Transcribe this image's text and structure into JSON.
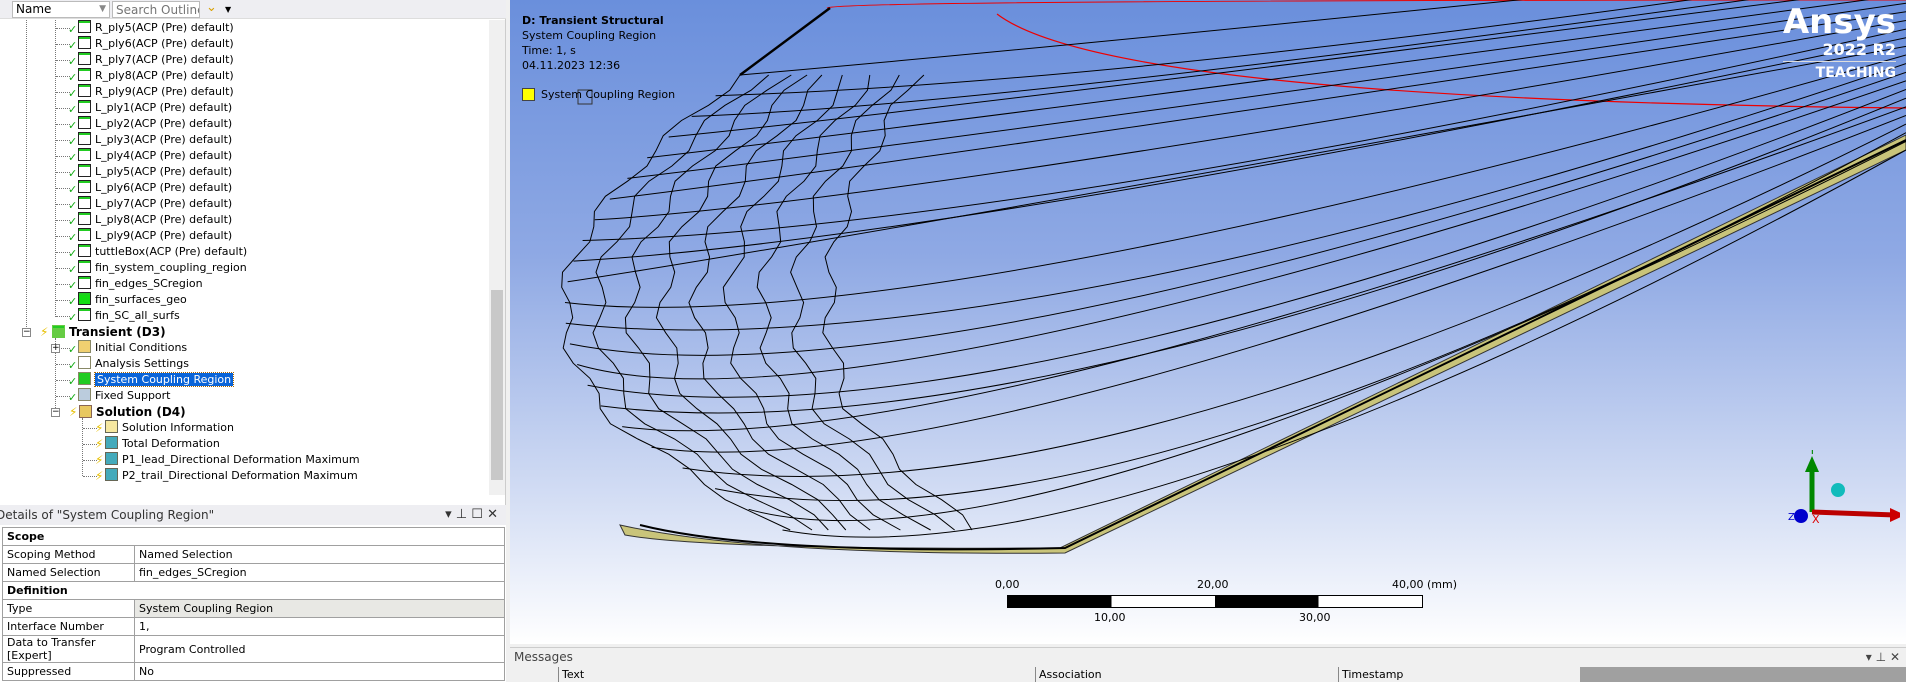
{
  "toolbar": {
    "name_filter": "Name",
    "search_placeholder": "Search Outline"
  },
  "tree": {
    "leaf_items": [
      "R_ply5(ACP (Pre) default)",
      "R_ply6(ACP (Pre) default)",
      "R_ply7(ACP (Pre) default)",
      "R_ply8(ACP (Pre) default)",
      "R_ply9(ACP (Pre) default)",
      "L_ply1(ACP (Pre) default)",
      "L_ply2(ACP (Pre) default)",
      "L_ply3(ACP (Pre) default)",
      "L_ply4(ACP (Pre) default)",
      "L_ply5(ACP (Pre) default)",
      "L_ply6(ACP (Pre) default)",
      "L_ply7(ACP (Pre) default)",
      "L_ply8(ACP (Pre) default)",
      "L_ply9(ACP (Pre) default)",
      "tuttleBox(ACP (Pre) default)",
      "fin_system_coupling_region",
      "fin_edges_SCregion",
      "fin_surfaces_geo",
      "fin_SC_all_surfs"
    ],
    "transient": "Transient (D3)",
    "transient_items": [
      "Initial Conditions",
      "Analysis Settings",
      "System Coupling Region",
      "Fixed Support"
    ],
    "solution": "Solution (D4)",
    "solution_items": [
      "Solution Information",
      "Total Deformation",
      "P1_lead_Directional Deformation Maximum",
      "P2_trail_Directional Deformation Maximum"
    ],
    "selected": "System Coupling Region"
  },
  "details": {
    "title": "Details of \"System Coupling Region\"",
    "rows": [
      {
        "category": "Scope"
      },
      {
        "label": "Scoping Method",
        "value": "Named Selection"
      },
      {
        "label": "Named Selection",
        "value": "fin_edges_SCregion"
      },
      {
        "category": "Definition"
      },
      {
        "label": "Type",
        "value": "System Coupling Region"
      },
      {
        "label": "Interface Number",
        "value": "1,"
      },
      {
        "label": "Data to Transfer [Expert]",
        "value": "Program Controlled"
      },
      {
        "label": "Suppressed",
        "value": "No"
      }
    ]
  },
  "viewport": {
    "title": "D: Transient Structural",
    "subtitle": "System Coupling Region",
    "time": "Time: 1, s",
    "date": "04.11.2023 12:36",
    "legend": "System Coupling Region",
    "legend_color": "#ffff00",
    "logo": {
      "brand": "Ansys",
      "release": "2022 R2",
      "edition": "TEACHING"
    },
    "scale": {
      "labels_top": [
        "0,00",
        "20,00",
        "40,00"
      ],
      "labels_bottom": [
        "10,00",
        "30,00"
      ],
      "unit": "(mm)"
    },
    "axes": {
      "x": "X",
      "y": "Y",
      "z": "Z"
    }
  },
  "messages": {
    "title": "Messages",
    "columns": [
      "Text",
      "Association",
      "Timestamp"
    ]
  }
}
